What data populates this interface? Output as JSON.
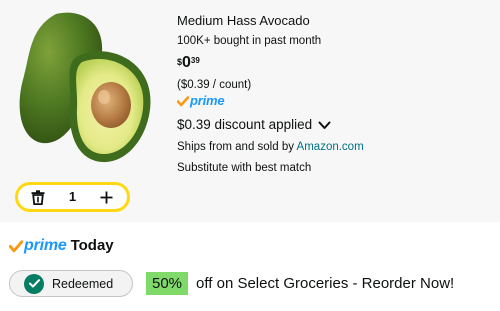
{
  "product": {
    "title": "Medium Hass Avocado",
    "bought": "100K+ bought in past month",
    "price": {
      "symbol": "$",
      "whole": "0",
      "fraction": "39"
    },
    "unit_price": "($0.39 / count)",
    "prime_label": "prime",
    "discount": "$0.39 discount applied",
    "ships_prefix": "Ships from and sold by ",
    "ships_seller": "Amazon.com",
    "substitute": "Substitute with best match"
  },
  "quantity": {
    "value": "1"
  },
  "prime_today": {
    "prime": "prime",
    "today": "Today"
  },
  "redeemed": {
    "label": "Redeemed"
  },
  "promo": {
    "percent": "50%",
    "text": "off on Select Groceries - Reorder Now!"
  },
  "colors": {
    "prime_blue": "#1a98ff",
    "prime_check": "#f79b16",
    "qty_border": "#ffd814",
    "redeemed_check": "#067d62",
    "promo_highlight": "#7fda69",
    "link": "#007185"
  },
  "icons": {
    "qty_decrement": "trash-icon",
    "qty_increment": "plus-icon",
    "discount_toggle": "chevron-down-icon",
    "redeemed_status": "checkmark-circle-icon",
    "prime_check": "prime-checkmark-icon"
  }
}
